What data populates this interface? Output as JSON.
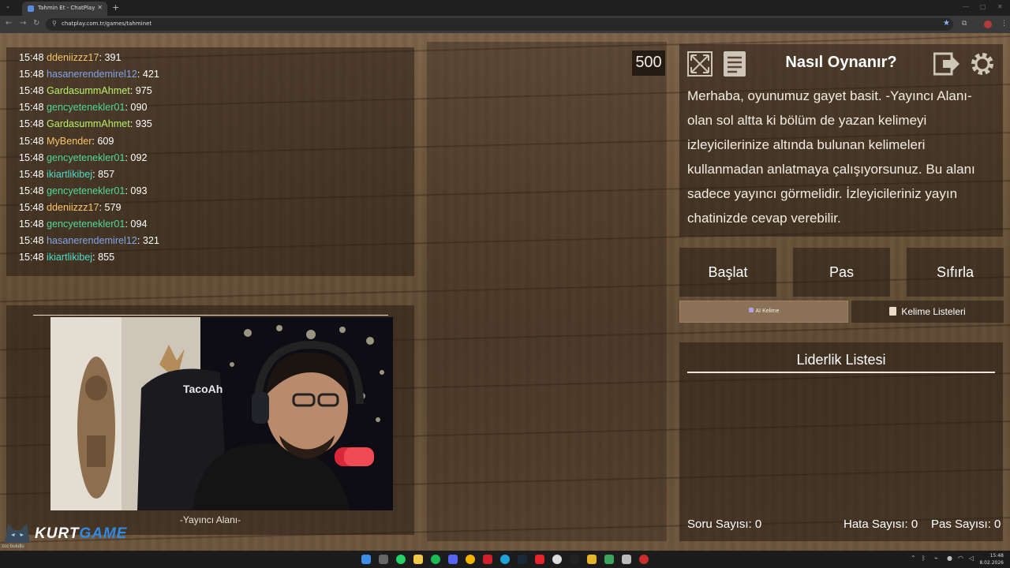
{
  "browser": {
    "tab_title": "Tahmin Et - ChatPlay",
    "url": "chatplay.com.tr/games/tahminet"
  },
  "chat": {
    "messages": [
      {
        "time": "15:48",
        "user": "ddeniizzz17",
        "text": ": 391",
        "color": "#f7c46a"
      },
      {
        "time": "15:48",
        "user": "hasanerendemirel12",
        "text": ": 421",
        "color": "#7fa4ea"
      },
      {
        "time": "15:48",
        "user": "GardasummAhmet",
        "text": ": 975",
        "color": "#b8f26a"
      },
      {
        "time": "15:48",
        "user": "gencyetenekler01",
        "text": ": 090",
        "color": "#4fd99c"
      },
      {
        "time": "15:48",
        "user": "GardasummAhmet",
        "text": ": 935",
        "color": "#b8f26a"
      },
      {
        "time": "15:48",
        "user": "MyBender",
        "text": ": 609",
        "color": "#f7c46a"
      },
      {
        "time": "15:48",
        "user": "gencyetenekler01",
        "text": ": 092",
        "color": "#4fd99c"
      },
      {
        "time": "15:48",
        "user": "ikiartlikibej",
        "text": ": 857",
        "color": "#4fd9c8"
      },
      {
        "time": "15:48",
        "user": "gencyetenekler01",
        "text": ": 093",
        "color": "#4fd99c"
      },
      {
        "time": "15:48",
        "user": "ddeniizzz17",
        "text": ": 579",
        "color": "#f7c46a"
      },
      {
        "time": "15:48",
        "user": "gencyetenekler01",
        "text": ": 094",
        "color": "#4fd99c"
      },
      {
        "time": "15:48",
        "user": "hasanerendemirel12",
        "text": ": 321",
        "color": "#7fa4ea"
      },
      {
        "time": "15:48",
        "user": "ikiartlikibej",
        "text": ": 855",
        "color": "#4fd9c8"
      }
    ]
  },
  "streamer": {
    "label": "-Yayıncı Alanı-",
    "chair_brand": "TacoAh"
  },
  "score": "500",
  "howto": {
    "title": "Nasıl Oynanır?",
    "text": "Merhaba, oyunumuz gayet basit. -Yayıncı Alanı- olan sol altta ki bölüm de yazan kelimeyi izleyicilerinize altında bulunan kelimeleri kullanmadan anlatmaya çalışıyorsunuz. Bu alanı sadece yayıncı görmelidir. İzleyicileriniz yayın chatinizde cevap verebilir."
  },
  "buttons": {
    "start": "Başlat",
    "pass": "Pas",
    "reset": "Sıfırla"
  },
  "subtabs": {
    "ai_word": "AI Kelime",
    "word_lists": "Kelime Listeleri"
  },
  "leaderboard": {
    "title": "Liderlik Listesi",
    "questions": "Soru Sayısı: 0",
    "errors": "Hata Sayısı: 0",
    "passes": "Pas Sayısı: 0"
  },
  "logo": {
    "part1": "KURT",
    "part2": "GAME",
    "sub": "zoc bulutlu"
  },
  "clock": {
    "time": "15:48",
    "date": "8.02.2026"
  }
}
